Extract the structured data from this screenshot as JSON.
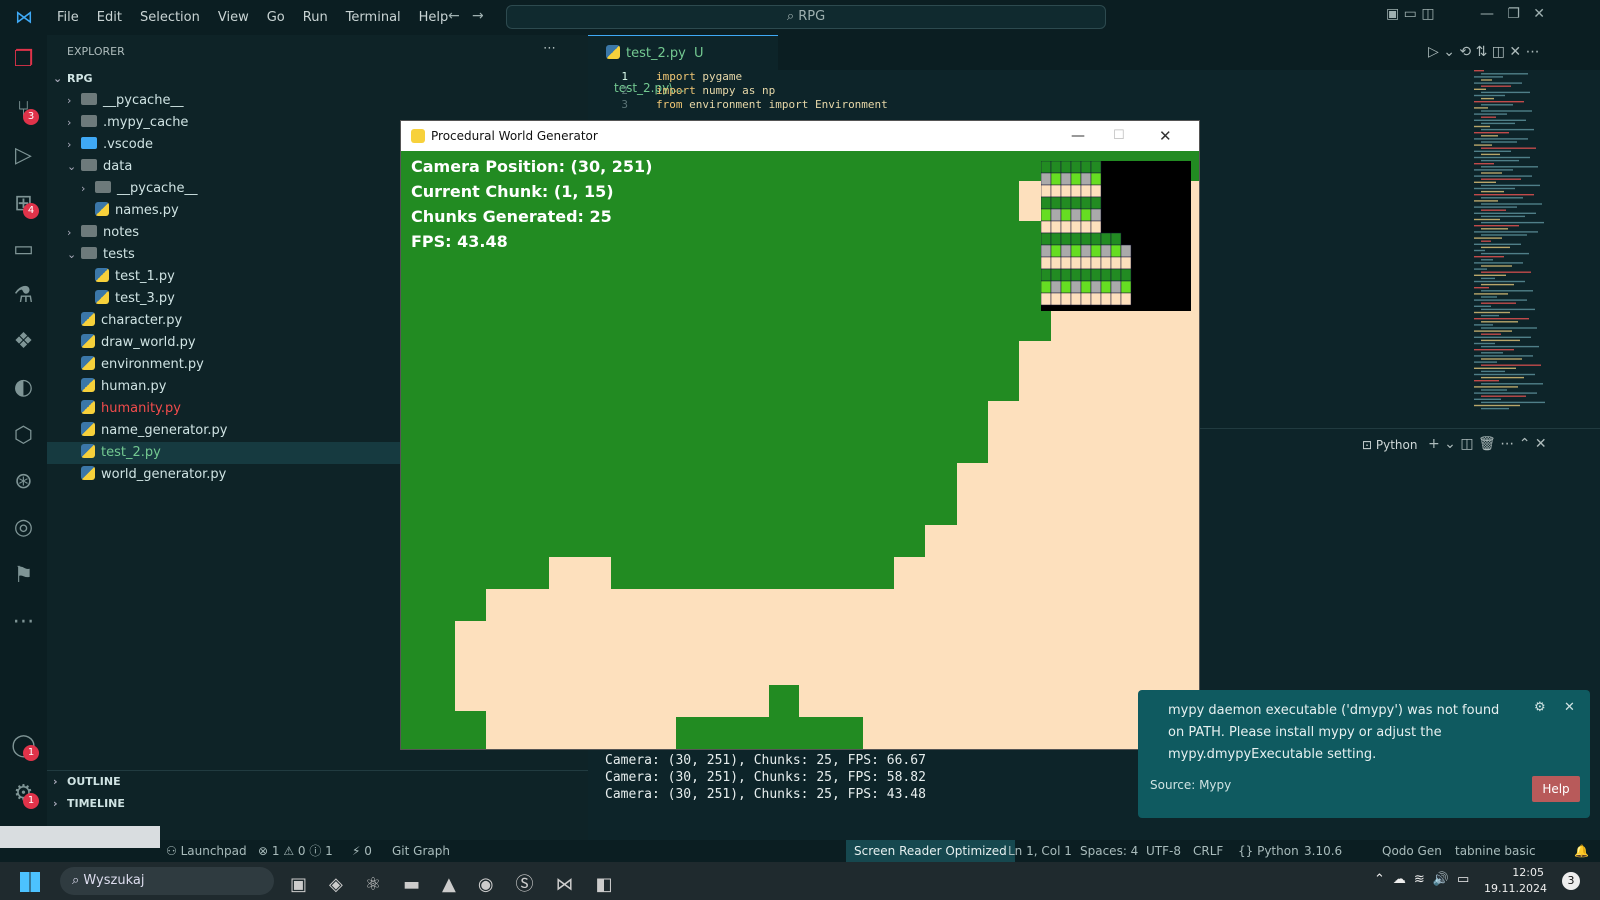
{
  "titlebar": {
    "menu": [
      "File",
      "Edit",
      "Selection",
      "View",
      "Go",
      "Run",
      "Terminal",
      "Help"
    ],
    "search": "RPG"
  },
  "activity_badges": {
    "scm": "3",
    "extensions": "4",
    "accounts": "1",
    "settings": "1"
  },
  "sidebar": {
    "header": "EXPLORER",
    "root": "RPG",
    "items": [
      {
        "label": "__pycache__",
        "kind": "folder",
        "depth": 1,
        "chev": "›",
        "color": "#cfe3e3"
      },
      {
        "label": ".mypy_cache",
        "kind": "folder",
        "depth": 1,
        "chev": "›",
        "color": "#cfe3e3"
      },
      {
        "label": ".vscode",
        "kind": "vscode",
        "depth": 1,
        "chev": "›",
        "color": "#cfe3e3"
      },
      {
        "label": "data",
        "kind": "folder",
        "depth": 1,
        "chev": "⌄",
        "color": "#cfe3e3"
      },
      {
        "label": "__pycache__",
        "kind": "folder",
        "depth": 2,
        "chev": "›",
        "color": "#cfe3e3"
      },
      {
        "label": "names.py",
        "kind": "py",
        "depth": 2,
        "chev": "",
        "color": "#cfe3e3"
      },
      {
        "label": "notes",
        "kind": "folder",
        "depth": 1,
        "chev": "›",
        "color": "#cfe3e3"
      },
      {
        "label": "tests",
        "kind": "folder",
        "depth": 1,
        "chev": "⌄",
        "color": "#cfe3e3"
      },
      {
        "label": "test_1.py",
        "kind": "py",
        "depth": 2,
        "chev": "",
        "color": "#cfe3e3"
      },
      {
        "label": "test_3.py",
        "kind": "py",
        "depth": 2,
        "chev": "",
        "color": "#cfe3e3"
      },
      {
        "label": "character.py",
        "kind": "py",
        "depth": 1,
        "chev": "",
        "color": "#cfe3e3"
      },
      {
        "label": "draw_world.py",
        "kind": "py",
        "depth": 1,
        "chev": "",
        "color": "#cfe3e3"
      },
      {
        "label": "environment.py",
        "kind": "py",
        "depth": 1,
        "chev": "",
        "color": "#cfe3e3"
      },
      {
        "label": "human.py",
        "kind": "py",
        "depth": 1,
        "chev": "",
        "color": "#cfe3e3"
      },
      {
        "label": "humanity.py",
        "kind": "py",
        "depth": 1,
        "chev": "",
        "color": "#f14c4c"
      },
      {
        "label": "name_generator.py",
        "kind": "py",
        "depth": 1,
        "chev": "",
        "color": "#cfe3e3"
      },
      {
        "label": "test_2.py",
        "kind": "py",
        "depth": 1,
        "chev": "",
        "color": "#73c991",
        "selected": true
      },
      {
        "label": "world_generator.py",
        "kind": "py",
        "depth": 1,
        "chev": "",
        "color": "#cfe3e3"
      }
    ],
    "outline": "OUTLINE",
    "timeline": "TIMELINE"
  },
  "editor": {
    "tab_name": "test_2.py",
    "tab_flag": "U",
    "tab_path": "test_2.py\\...",
    "lines": [
      {
        "num": "1",
        "kw": "import",
        "rest": " pygame"
      },
      {
        "num": "2",
        "kw": "import",
        "rest": " numpy as np"
      },
      {
        "num": "3",
        "kw": "from",
        "rest": " environment import Environment"
      }
    ],
    "terminal_tab": "Python"
  },
  "pygame": {
    "title": "Procedural World Generator",
    "hud": [
      "Camera Position: (30, 251)",
      "Current Chunk: (1, 15)",
      "Chunks Generated: 25",
      "FPS: 43.48"
    ],
    "colors": {
      "grass": "#228b22",
      "sand": "#fde0bd",
      "map_bg": "#000000"
    }
  },
  "terminal": [
    "Camera: (30, 251), Chunks: 25, FPS: 66.67",
    "Camera: (30, 251), Chunks: 25, FPS: 58.82",
    "Camera: (30, 251), Chunks: 25, FPS: 43.48"
  ],
  "notification": {
    "message": "mypy daemon executable ('dmypy') was not found on PATH. Please install mypy or adjust the mypy.dmypyExecutable setting.",
    "source": "Source: Mypy",
    "help": "Help"
  },
  "statusbar": {
    "launchpad": "Launchpad",
    "problems": "⊗ 1 ⚠ 0 ⓘ 1",
    "ports": "0",
    "git": "Git Graph",
    "screen_reader": "Screen Reader Optimized",
    "position": "Ln 1, Col 1",
    "spaces": "Spaces: 4",
    "encoding": "UTF-8",
    "eol": "CRLF",
    "language": "Python",
    "version": "3.10.6",
    "qodo": "Qodo Gen",
    "tabnine": "tabnine basic"
  },
  "taskbar": {
    "search": "Wyszukaj",
    "time": "12:05",
    "date": "19.11.2024",
    "notif_count": "3"
  }
}
